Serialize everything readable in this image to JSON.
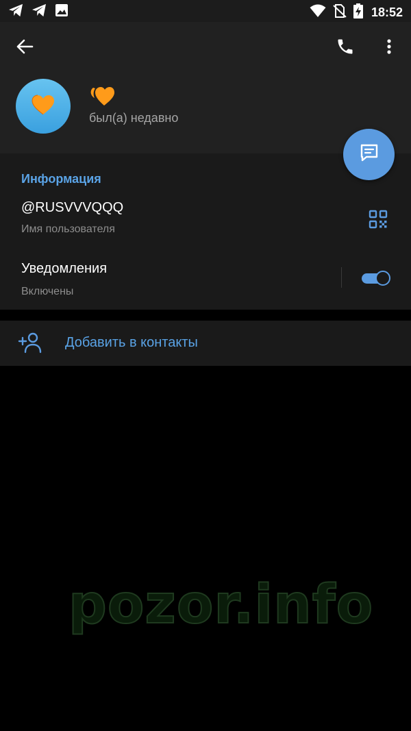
{
  "status_bar": {
    "time": "18:52",
    "left_icons": [
      "telegram-icon",
      "telegram-icon",
      "image-icon"
    ],
    "right_icons": [
      "wifi-icon",
      "no-sim-icon",
      "battery-charging-icon"
    ]
  },
  "header": {
    "back_icon": "arrow-left-icon",
    "call_icon": "phone-icon",
    "menu_icon": "more-vertical-icon"
  },
  "profile": {
    "avatar_emoji": "🧡",
    "name": "🧡",
    "status": "был(а) недавно"
  },
  "fab": {
    "icon": "message-icon"
  },
  "info": {
    "title": "Информация",
    "username": "@RUSVVVQQQ",
    "username_caption": "Имя пользователя",
    "notifications_label": "Уведомления",
    "notifications_caption": "Включены",
    "notifications_enabled": true
  },
  "add_contact": {
    "label": "Добавить в контакты",
    "icon": "add-user-icon"
  },
  "watermark": "pozor.info",
  "colors": {
    "accent": "#5b9be0",
    "accent_text": "#5aa3e6",
    "header_bg": "#212121",
    "section_bg": "#1a1a1a",
    "page_bg": "#000000"
  }
}
